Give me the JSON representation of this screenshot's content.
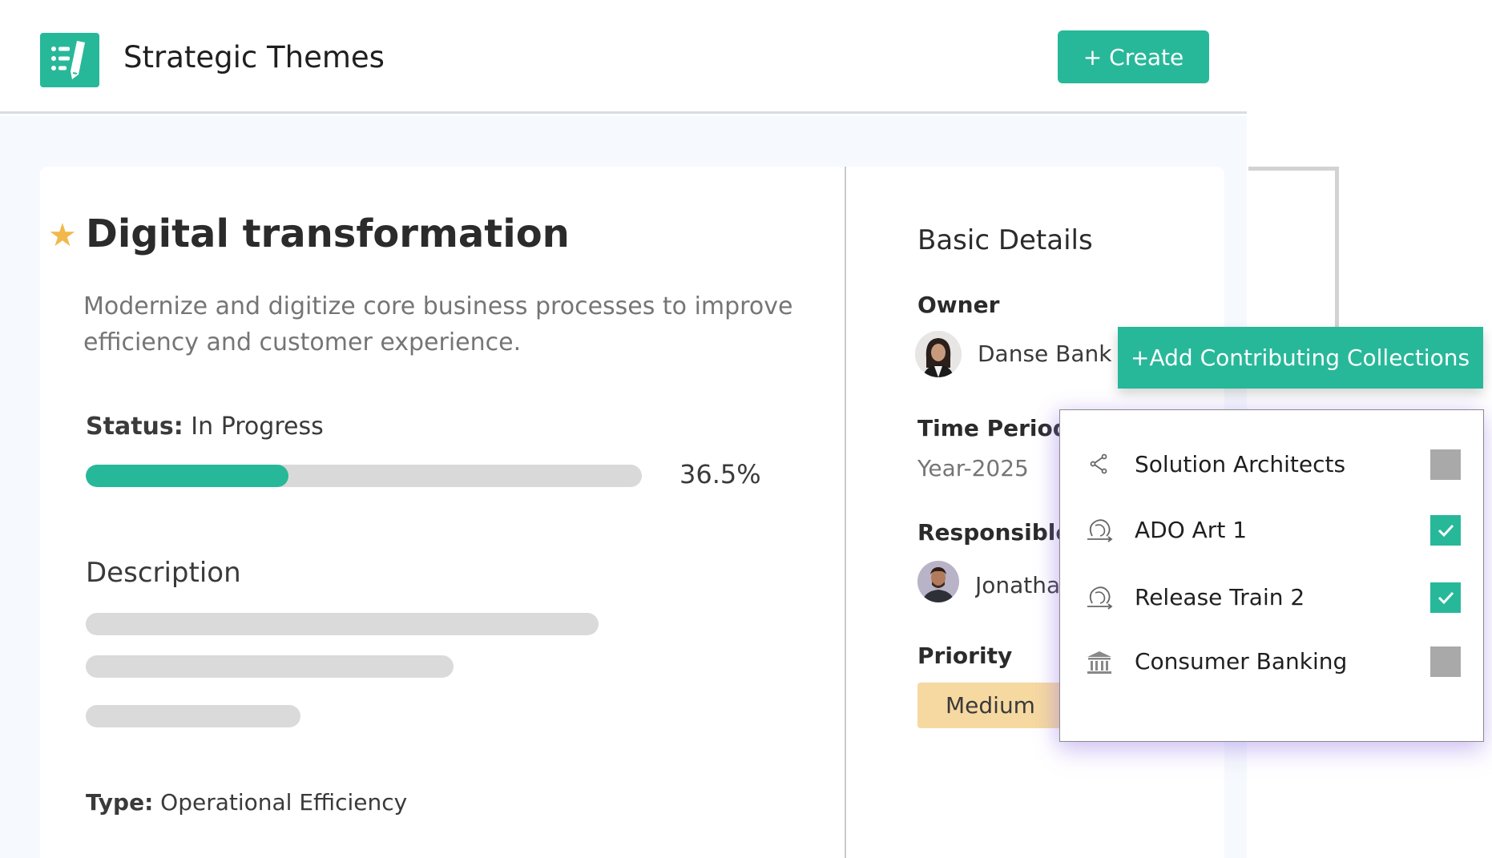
{
  "header": {
    "app_icon": "edit-list-icon",
    "title": "Strategic Themes",
    "create_label": "+ Create"
  },
  "theme": {
    "favorite_icon": "star-icon",
    "title": "Digital transformation",
    "summary": "Modernize and digitize core business processes to improve efficiency and customer experience.",
    "status_label": "Status:",
    "status_value": "In Progress",
    "progress_percent": 36.5,
    "progress_text": "36.5%",
    "description_heading": "Description",
    "type_label": "Type:",
    "type_value": "Operational Efficiency"
  },
  "details": {
    "heading": "Basic Details",
    "owner_label": "Owner",
    "owner_name": "Danse Bank",
    "time_period_label": "Time Period",
    "time_period_value": "Year-2025",
    "responsible_label": "Responsible",
    "responsible_name": "Jonatha",
    "priority_label": "Priority",
    "priority_value": "Medium"
  },
  "collections": {
    "add_label": "+Add Contributing Collections",
    "items": [
      {
        "label": "Solution Architects",
        "icon": "share-icon",
        "checked": false
      },
      {
        "label": "ADO Art 1",
        "icon": "cycle-icon",
        "checked": true
      },
      {
        "label": "Release Train 2",
        "icon": "cycle-icon",
        "checked": true
      },
      {
        "label": "Consumer Banking",
        "icon": "bank-icon",
        "checked": false
      }
    ]
  },
  "colors": {
    "accent": "#27b899",
    "star": "#f2b84b",
    "priority_medium": "#f6d9a1",
    "track": "#d9d9d9",
    "unchecked": "#a9a9a9"
  }
}
